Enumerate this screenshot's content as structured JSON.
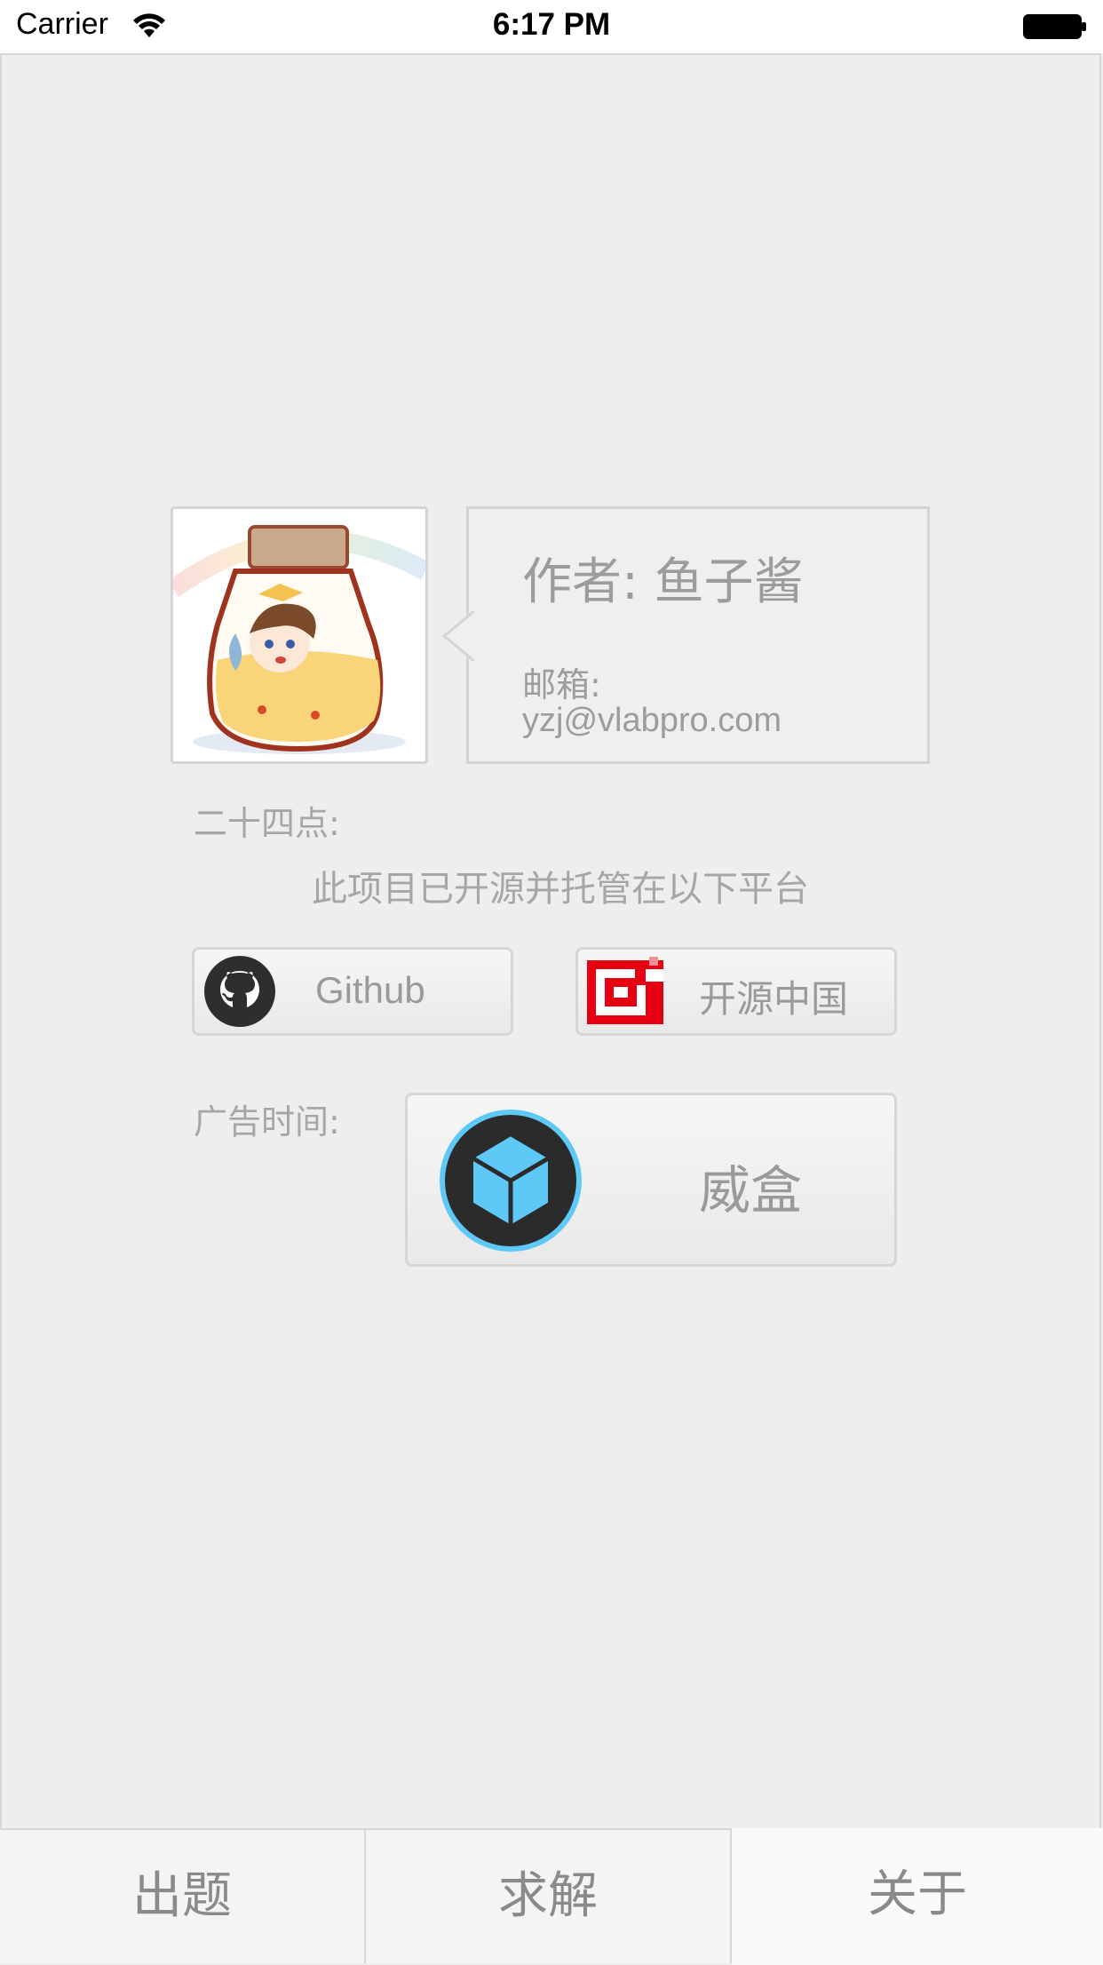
{
  "status_bar": {
    "carrier": "Carrier",
    "time": "6:17 PM"
  },
  "about": {
    "author": "作者: 鱼子酱",
    "email_label": "邮箱:",
    "email": "yzj@vlabpro.com",
    "project_label": "二十四点:",
    "opensource_note": "此项目已开源并托管在以下平台",
    "ad_label": "广告时间:"
  },
  "buttons": {
    "github": "Github",
    "oschina": "开源中国",
    "weihe": "威盒"
  },
  "tabs": [
    {
      "label": "出题",
      "selected": false
    },
    {
      "label": "求解",
      "selected": false
    },
    {
      "label": "关于",
      "selected": true
    }
  ],
  "icons": {
    "github": "github-octocat-icon",
    "oschina": "oschina-logo-icon",
    "weihe": "cube-logo-icon",
    "avatar": "anime-character-in-jar-avatar"
  },
  "colors": {
    "background": "#eeeeee",
    "text_muted": "#9c9c9c",
    "oschina_red": "#e60012",
    "weihe_blue": "#5ec8f7",
    "weihe_dark": "#2b2b2b"
  }
}
